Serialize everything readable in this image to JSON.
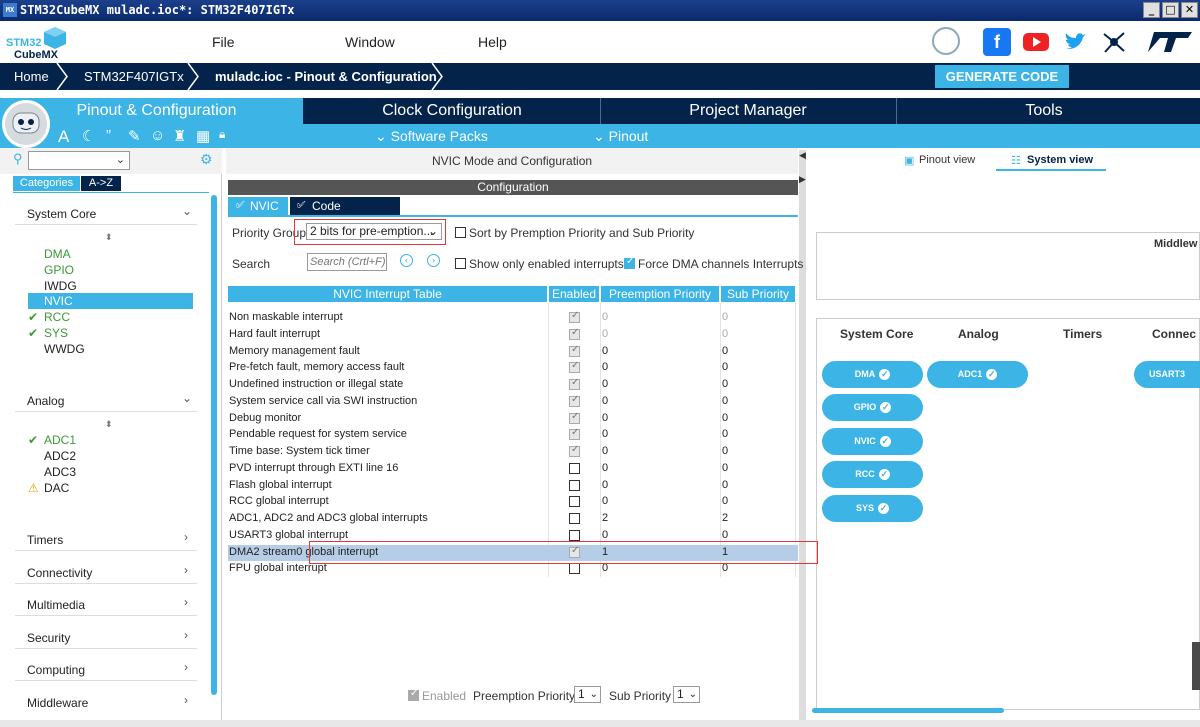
{
  "window": {
    "title": "STM32CubeMX muladc.ioc*: STM32F407IGTx",
    "min": "_",
    "max": "□",
    "close": "✕"
  },
  "logo": {
    "line1": "STM32",
    "line2": "CubeMX"
  },
  "menu": {
    "file": "File",
    "window": "Window",
    "help": "Help"
  },
  "breadcrumb": {
    "home": "Home",
    "device": "STM32F407IGTx",
    "project": "muladc.ioc - Pinout & Configuration"
  },
  "generate_label": "GENERATE CODE",
  "tabs": [
    "Pinout & Configuration",
    "Clock Configuration",
    "Project Manager",
    "Tools"
  ],
  "subbar": {
    "software_packs": "⌄ Software Packs",
    "pinout": "⌄ Pinout"
  },
  "left": {
    "categories": "Categories",
    "az": "A->Z",
    "system_core": "System Core",
    "system_core_items": [
      "DMA",
      "GPIO",
      "IWDG",
      "NVIC",
      "RCC",
      "SYS",
      "WWDG"
    ],
    "analog": "Analog",
    "analog_items": [
      "ADC1",
      "ADC2",
      "ADC3",
      "DAC"
    ],
    "groups": [
      "Timers",
      "Connectivity",
      "Multimedia",
      "Security",
      "Computing",
      "Middleware"
    ]
  },
  "center": {
    "header": "NVIC Mode and Configuration",
    "configuration": "Configuration",
    "tab_nvic": "NVIC",
    "tab_codegen": "Code generation",
    "priority_group_label": "Priority Group",
    "priority_group_value": "2 bits for pre-emption...",
    "sort_label": "Sort by Premption Priority and Sub Priority",
    "search_label": "Search",
    "search_placeholder": "Search (Crtl+F)",
    "only_enabled": "Show only enabled interrupts",
    "force_dma": "Force DMA channels Interrupts",
    "columns": [
      "NVIC Interrupt Table",
      "Enabled",
      "Preemption Priority",
      "Sub Priority"
    ],
    "rows": [
      {
        "name": "Non maskable interrupt",
        "enabled": true,
        "pp": "0",
        "sp": "0",
        "locked": true
      },
      {
        "name": "Hard fault interrupt",
        "enabled": true,
        "pp": "0",
        "sp": "0",
        "locked": true
      },
      {
        "name": "Memory management fault",
        "enabled": true,
        "pp": "0",
        "sp": "0"
      },
      {
        "name": "Pre-fetch fault, memory access fault",
        "enabled": true,
        "pp": "0",
        "sp": "0"
      },
      {
        "name": "Undefined instruction or illegal state",
        "enabled": true,
        "pp": "0",
        "sp": "0"
      },
      {
        "name": "System service call via SWI instruction",
        "enabled": true,
        "pp": "0",
        "sp": "0"
      },
      {
        "name": "Debug monitor",
        "enabled": true,
        "pp": "0",
        "sp": "0"
      },
      {
        "name": "Pendable request for system service",
        "enabled": true,
        "pp": "0",
        "sp": "0"
      },
      {
        "name": "Time base: System tick timer",
        "enabled": true,
        "pp": "0",
        "sp": "0"
      },
      {
        "name": "PVD interrupt through EXTI line 16",
        "enabled": false,
        "pp": "0",
        "sp": "0"
      },
      {
        "name": "Flash global interrupt",
        "enabled": false,
        "pp": "0",
        "sp": "0"
      },
      {
        "name": "RCC global interrupt",
        "enabled": false,
        "pp": "0",
        "sp": "0"
      },
      {
        "name": "ADC1, ADC2 and ADC3 global interrupts",
        "enabled": false,
        "pp": "2",
        "sp": "2"
      },
      {
        "name": "USART3 global interrupt",
        "enabled": false,
        "pp": "0",
        "sp": "0"
      },
      {
        "name": "DMA2 stream0 global interrupt",
        "enabled": true,
        "pp": "1",
        "sp": "1",
        "selected": true
      },
      {
        "name": "FPU global interrupt",
        "enabled": false,
        "pp": "0",
        "sp": "0"
      }
    ],
    "footer": {
      "enabled": "Enabled",
      "preemption": "Preemption Priority",
      "pp_value": "1",
      "sub": "Sub Priority",
      "sp_value": "1"
    }
  },
  "right": {
    "pinout_view": "Pinout view",
    "system_view": "System view",
    "middleware_label": "Middlew",
    "col_system_core": "System Core",
    "col_analog": "Analog",
    "col_timers": "Timers",
    "col_connectivity": "Connec",
    "system_core_pills": [
      "DMA",
      "GPIO",
      "NVIC",
      "RCC",
      "SYS"
    ],
    "analog_pills": [
      "ADC1"
    ],
    "connectivity_pills": [
      "USART3"
    ]
  },
  "colors": {
    "navy": "#03234b",
    "accent": "#3cb4e5",
    "green": "#3a9a36",
    "highlight": "#e33333"
  }
}
